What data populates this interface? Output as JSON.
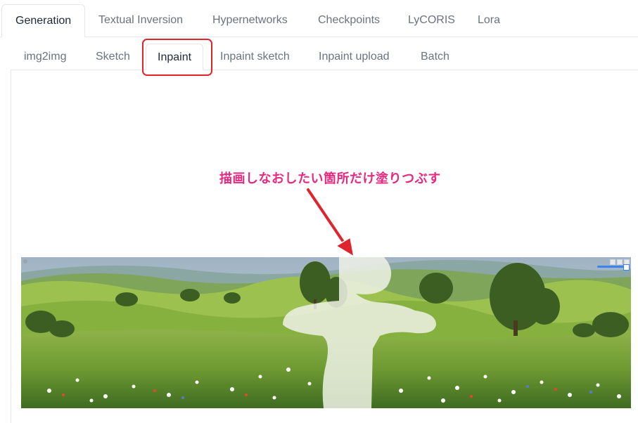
{
  "top_tabs": [
    {
      "label": "Generation",
      "active": true
    },
    {
      "label": "Textual Inversion",
      "active": false
    },
    {
      "label": "Hypernetworks",
      "active": false
    },
    {
      "label": "Checkpoints",
      "active": false
    },
    {
      "label": "LyCORIS",
      "active": false
    },
    {
      "label": "Lora",
      "active": false
    }
  ],
  "sub_tabs": [
    {
      "label": "img2img",
      "active": false
    },
    {
      "label": "Sketch",
      "active": false
    },
    {
      "label": "Inpaint",
      "active": true
    },
    {
      "label": "Inpaint sketch",
      "active": false
    },
    {
      "label": "Inpaint upload",
      "active": false
    },
    {
      "label": "Batch",
      "active": false
    }
  ],
  "annotation": {
    "text": "描画しなおしたい箇所だけ塗りつぶす",
    "color": "#e8287f"
  },
  "highlight_color": "#e0242e",
  "canvas": {
    "image": "painted-meadow-landscape",
    "mask_color": "#eef2e6"
  },
  "colors": {
    "active_tab_text": "#1f2937",
    "inactive_tab_text": "#6b7280",
    "border": "#e5e7eb"
  }
}
